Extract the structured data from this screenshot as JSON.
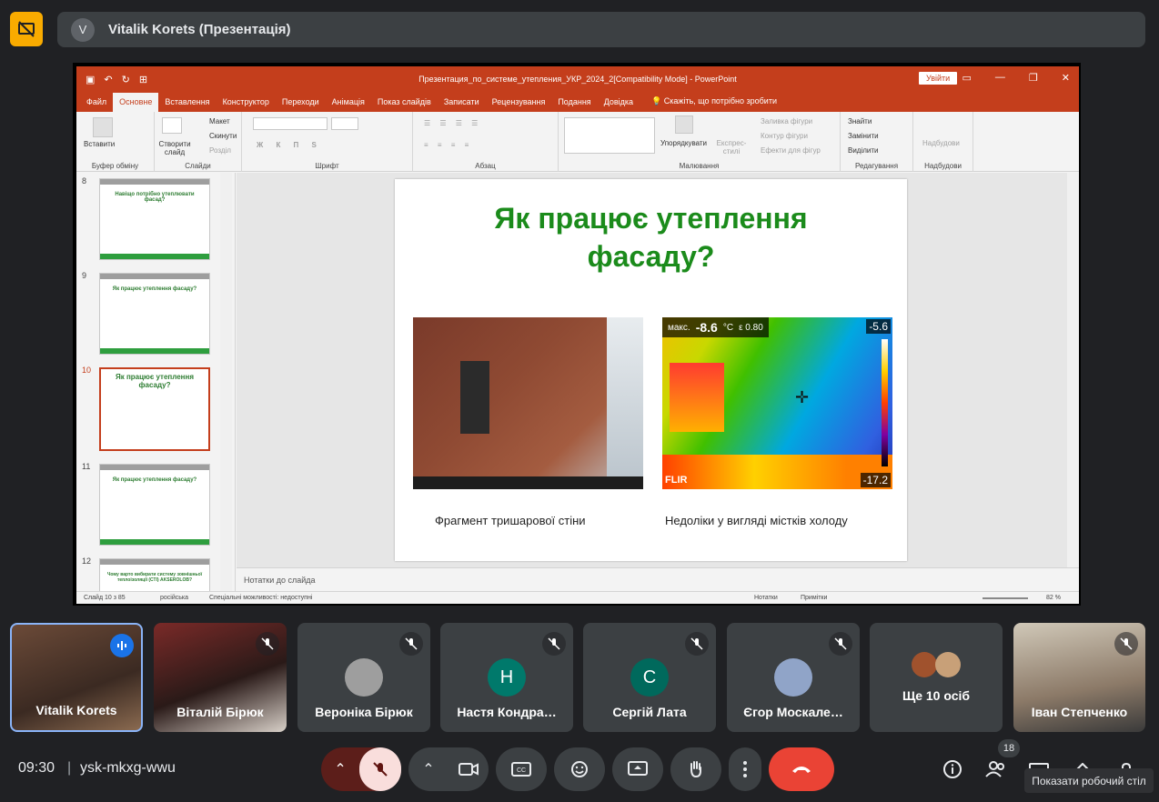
{
  "meet": {
    "presenter_label": "Vitalik Korets (Презентація)",
    "presenter_initial": "V",
    "time": "09:30",
    "separator": "|",
    "meeting_code": "ysk-mkxg-wwu",
    "participants_count": "18",
    "tooltip": "Показати робочий стіл",
    "tiles": [
      {
        "name": "Vitalik Korets",
        "type": "video",
        "speaking": true
      },
      {
        "name": "Віталій Бірюк",
        "type": "video",
        "muted": true
      },
      {
        "name": "Вероніка Бірюк",
        "type": "avatar",
        "muted": true
      },
      {
        "name": "Настя Кондра…",
        "type": "letter",
        "letter": "Н",
        "color": "#00796b",
        "muted": true
      },
      {
        "name": "Сергій Лата",
        "type": "letter",
        "letter": "С",
        "color": "#00695c",
        "muted": true
      },
      {
        "name": "Єгор Москале…",
        "type": "avatar",
        "muted": true
      },
      {
        "name": "Ще 10 осіб",
        "type": "group"
      },
      {
        "name": "Іван Степченко",
        "type": "video",
        "muted": true
      }
    ],
    "controls": [
      "chevron-up",
      "mic-off",
      "chevron-up",
      "camera",
      "captions",
      "emoji",
      "present",
      "raise-hand",
      "more",
      "end-call"
    ],
    "right_controls": [
      "info",
      "people",
      "chat",
      "activities",
      "lock"
    ]
  },
  "ppt": {
    "title": "Презентация_по_системе_утепления_УКР_2024_2[Compatibility Mode]  -  PowerPoint",
    "signin": "Увійти",
    "tabs": [
      "Файл",
      "Основне",
      "Вставлення",
      "Конструктор",
      "Переходи",
      "Анімація",
      "Показ слайдів",
      "Записати",
      "Рецензування",
      "Подання",
      "Довідка"
    ],
    "active_tab": "Основне",
    "tell_me": "Скажіть, що потрібно зробити",
    "ribbon": {
      "paste": "Вставити",
      "clipboard": "Буфер обміну",
      "new_slide": "Створити слайд",
      "layout": "Макет",
      "reset": "Скинути",
      "section": "Розділ",
      "slides": "Слайди",
      "font": "Шрифт",
      "paragraph": "Абзац",
      "arrange": "Упорядкувати",
      "quick_styles": "Експрес-стилі",
      "shape_fill": "Заливка фігури",
      "shape_outline": "Контур фігури",
      "shape_effects": "Ефекти для фігур",
      "drawing": "Малювання",
      "find": "Знайти",
      "replace": "Замінити",
      "select": "Виділити",
      "editing": "Редагування",
      "addins_btn": "Надбудови",
      "addins": "Надбудови"
    },
    "thumbnails": [
      {
        "num": "8",
        "title": "Навіщо потрібно утеплювати фасад?"
      },
      {
        "num": "9",
        "title": "Як працює утеплення фасаду?"
      },
      {
        "num": "10",
        "title": "Як працює утеплення фасаду?",
        "active": true
      },
      {
        "num": "11",
        "title": "Як працює утеплення фасаду?"
      },
      {
        "num": "12",
        "title": "Чому варто вибирати систему зовнішньої теплоізоляції (СТІ) AKSEROLOB?"
      }
    ],
    "slide": {
      "title": "Як працює утеплення фасаду?",
      "caption_left": "Фрагмент тришарової стіни",
      "caption_right": "Недоліки у вигляді містків холоду",
      "ir_max_label": "макс.",
      "ir_max_value": "-8.6",
      "ir_unit": "°C",
      "ir_emissivity": "ε 0.80",
      "ir_top": "-5.6",
      "ir_bottom": "-17.2",
      "ir_brand": "FLIR"
    },
    "notes_placeholder": "Нотатки до слайда",
    "status": {
      "slide": "Слайд 10 з 85",
      "language": "російська",
      "accessibility": "Спеціальні можливості: недоступні",
      "notes": "Нотатки",
      "comments": "Примітки",
      "zoom": "82 %"
    }
  }
}
